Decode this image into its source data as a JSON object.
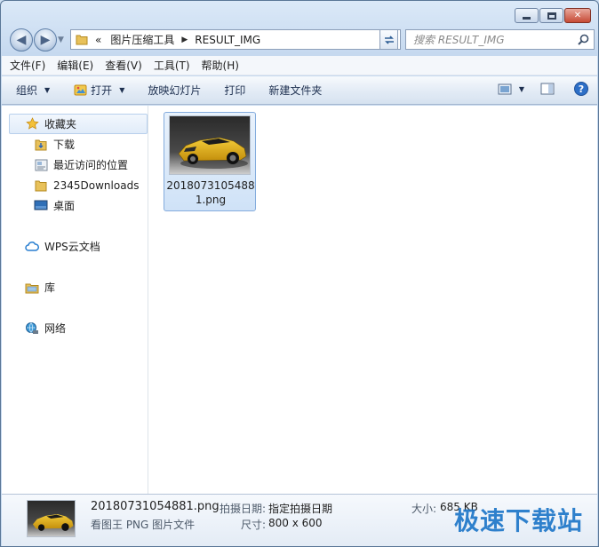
{
  "window": {
    "caption_buttons": [
      "minimize",
      "maximize",
      "close"
    ]
  },
  "address_bar": {
    "overflow_marker": "«",
    "breadcrumbs": [
      "图片压缩工具",
      "RESULT_IMG"
    ],
    "search_placeholder": "搜索 RESULT_IMG"
  },
  "menu": [
    "文件(F)",
    "编辑(E)",
    "查看(V)",
    "工具(T)",
    "帮助(H)"
  ],
  "toolbar": {
    "organize": "组织",
    "open": "打开",
    "slideshow": "放映幻灯片",
    "print": "打印",
    "new_folder": "新建文件夹"
  },
  "sidebar": {
    "favorites": "收藏夹",
    "favorites_items": [
      "下载",
      "最近访问的位置",
      "2345Downloads",
      "桌面"
    ],
    "wps": "WPS云文档",
    "library": "库",
    "network": "网络"
  },
  "files": [
    {
      "name": "20180731054881.png",
      "selected": true
    }
  ],
  "details": {
    "name": "20180731054881.png",
    "type": "看图王 PNG 图片文件",
    "date_label": "拍摄日期:",
    "date_value": "指定拍摄日期",
    "size_label": "大小:",
    "size_value": "685 KB",
    "dims_label": "尺寸:",
    "dims_value": "800 x 600"
  },
  "watermark": "极速下载站",
  "colors": {
    "accent_blue": "#1a74c8",
    "selection_border": "#84acdd",
    "car_yellow": "#e6b514"
  }
}
